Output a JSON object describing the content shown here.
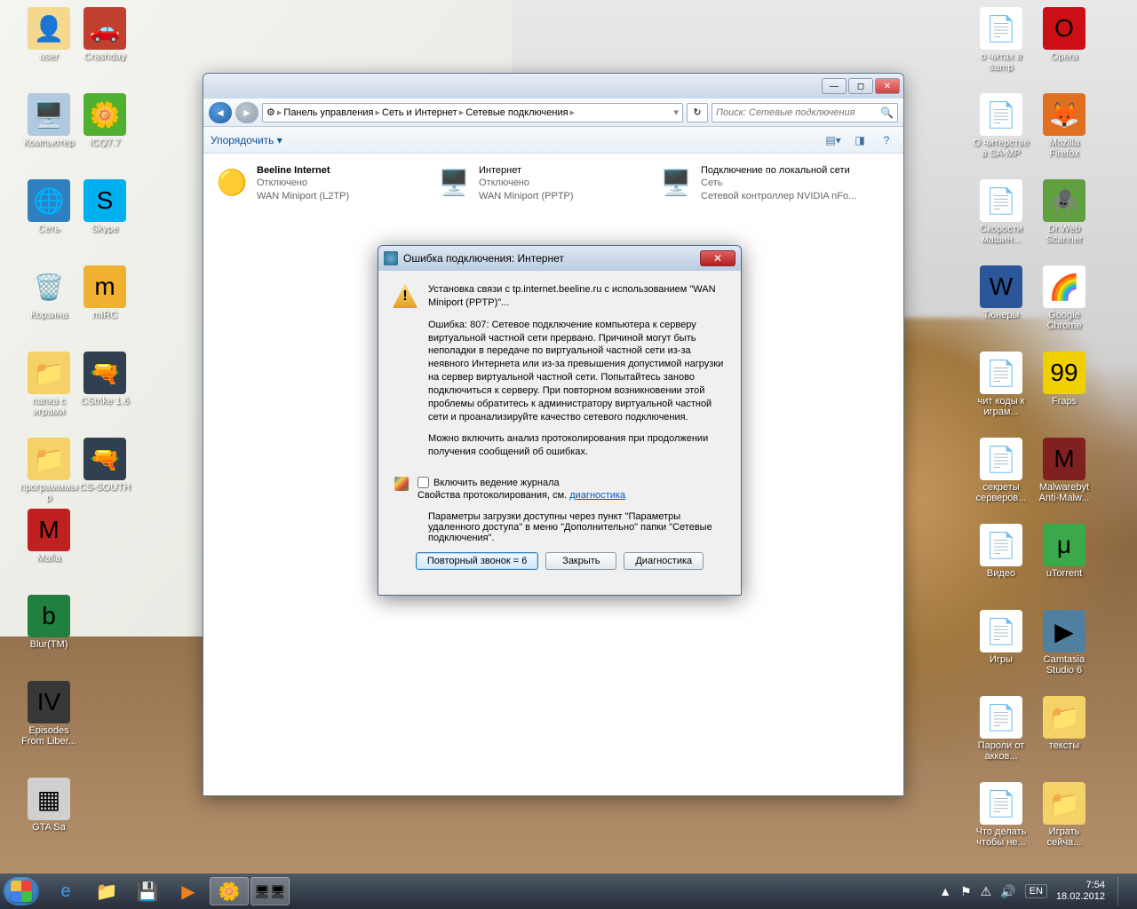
{
  "desktop_icons_left": [
    {
      "name": "user",
      "label": "user",
      "bg": "#f4d890",
      "emoji": "👤"
    },
    {
      "name": "crashday",
      "label": "Crashday",
      "bg": "#c04030",
      "emoji": "🚗"
    },
    {
      "name": "computer",
      "label": "Компьютер",
      "bg": "#b0c8e0",
      "emoji": "🖥️"
    },
    {
      "name": "icq",
      "label": "ICQ7.7",
      "bg": "#50b030",
      "emoji": "🌼"
    },
    {
      "name": "network",
      "label": "Сеть",
      "bg": "#3080c0",
      "emoji": "🌐"
    },
    {
      "name": "skype",
      "label": "Skype",
      "bg": "#00aff0",
      "emoji": "S"
    },
    {
      "name": "recycle",
      "label": "Корзина",
      "bg": "transparent",
      "emoji": "🗑️"
    },
    {
      "name": "mirc",
      "label": "mIRC",
      "bg": "#f0b030",
      "emoji": "m"
    },
    {
      "name": "games-folder",
      "label": "папка с играми",
      "bg": "#f4d268",
      "emoji": "📁"
    },
    {
      "name": "cstrike",
      "label": "CStrike 1.6",
      "bg": "#304050",
      "emoji": "🔫"
    },
    {
      "name": "programs",
      "label": "программмы р",
      "bg": "#f4d268",
      "emoji": "📁"
    },
    {
      "name": "cs-south",
      "label": "CS-SOUTH",
      "bg": "#304050",
      "emoji": "🔫"
    },
    {
      "name": "mafia",
      "label": "Mafia",
      "bg": "#c02020",
      "emoji": "M"
    },
    {
      "name": "blur",
      "label": "Blur(TM)",
      "bg": "#208040",
      "emoji": "b"
    },
    {
      "name": "gta4",
      "label": "Episodes From Liber...",
      "bg": "#383838",
      "emoji": "IV"
    },
    {
      "name": "gtasa",
      "label": "GTA Sa",
      "bg": "#d0d0d0",
      "emoji": "▦"
    }
  ],
  "desktop_icons_right": [
    {
      "name": "txt1",
      "label": "о читах в samp",
      "bg": "#fff",
      "emoji": "📄"
    },
    {
      "name": "opera",
      "label": "Opera",
      "bg": "#cc0f16",
      "emoji": "O"
    },
    {
      "name": "txt2",
      "label": "О читерстве в SA-MP",
      "bg": "#fff",
      "emoji": "📄"
    },
    {
      "name": "firefox",
      "label": "Mozilla Firefox",
      "bg": "#e07020",
      "emoji": "🦊"
    },
    {
      "name": "txt3",
      "label": "Скорости машин...",
      "bg": "#fff",
      "emoji": "📄"
    },
    {
      "name": "drweb",
      "label": "Dr.Web Scanner",
      "bg": "#60a040",
      "emoji": "🕷️"
    },
    {
      "name": "tuners",
      "label": "Тюнеры",
      "bg": "#2b579a",
      "emoji": "W"
    },
    {
      "name": "chrome",
      "label": "Google Chrome",
      "bg": "#fff",
      "emoji": "🌈"
    },
    {
      "name": "txt4",
      "label": "чит коды к играм...",
      "bg": "#fff",
      "emoji": "📄"
    },
    {
      "name": "fraps",
      "label": "Fraps",
      "bg": "#f0d000",
      "emoji": "99"
    },
    {
      "name": "txt5",
      "label": "секреты серверов...",
      "bg": "#fff",
      "emoji": "📄"
    },
    {
      "name": "malwarebytes",
      "label": "Malwarebyt Anti-Malw...",
      "bg": "#802020",
      "emoji": "M"
    },
    {
      "name": "video",
      "label": "Видео",
      "bg": "#fff",
      "emoji": "📄"
    },
    {
      "name": "utorrent",
      "label": "uTorrent",
      "bg": "#3aa94a",
      "emoji": "μ"
    },
    {
      "name": "igry",
      "label": "Игры",
      "bg": "#fff",
      "emoji": "📄"
    },
    {
      "name": "camtasia",
      "label": "Camtasia Studio 6",
      "bg": "#5080a0",
      "emoji": "▶"
    },
    {
      "name": "txt6",
      "label": "Пароли от акков...",
      "bg": "#fff",
      "emoji": "📄"
    },
    {
      "name": "texts",
      "label": "тексты",
      "bg": "#f4d268",
      "emoji": "📁"
    },
    {
      "name": "txt7",
      "label": "Что делать чтобы не...",
      "bg": "#fff",
      "emoji": "📄"
    },
    {
      "name": "play-now",
      "label": "Играть сейча...",
      "bg": "#f4d268",
      "emoji": "📁"
    }
  ],
  "explorer": {
    "breadcrumb": [
      "Панель управления",
      "Сеть и Интернет",
      "Сетевые подключения"
    ],
    "search_placeholder": "Поиск: Сетевые подключения",
    "toolbar_organize": "Упорядочить ▾",
    "connections": [
      {
        "icon": "🟡",
        "title": "Beeline Internet",
        "status": "Отключено",
        "device": "WAN Miniport (L2TP)",
        "bold": true
      },
      {
        "icon": "🖥️",
        "title": "Интернет",
        "status": "Отключено",
        "device": "WAN Miniport (PPTP)"
      },
      {
        "icon": "🖥️",
        "title": "Подключение по локальной сети",
        "status": "Сеть",
        "device": "Сетевой контроллер NVIDIA nFo..."
      }
    ]
  },
  "dialog": {
    "title": "Ошибка подключения: Интернет",
    "line1": "Установка связи с tp.internet.beeline.ru с использованием \"WAN Miniport (PPTP)\"...",
    "line2": "Ошибка: 807: Сетевое подключение компьютера к серверу виртуальной частной сети прервано.  Причиной могут быть неполадки в передаче по виртуальной частной сети из-за неявного Интернета или из-за превышения допустимой нагрузки на сервер виртуальной частной сети.  Попытайтесь заново подключиться к серверу.  При повторном возникновении этой проблемы обратитесь к администратору виртуальной частной сети и проанализируйте качество сетевого подключения.",
    "line3": "Можно включить анализ протоколирования при продолжении получения сообщений об ошибках.",
    "cb_label": "Включить ведение журнала",
    "cb_sub_pre": "Свойства протоколирования, см. ",
    "cb_link": "диагностика",
    "params": "Параметры загрузки доступны через пункт \"Параметры удаленного доступа\" в меню \"Дополнительно\" папки \"Сетевые подключения\".",
    "btn_redial": "Повторный звонок = 6",
    "btn_close": "Закрыть",
    "btn_diag": "Диагностика"
  },
  "taskbar": {
    "lang": "EN",
    "time": "7:54",
    "date": "18.02.2012"
  }
}
